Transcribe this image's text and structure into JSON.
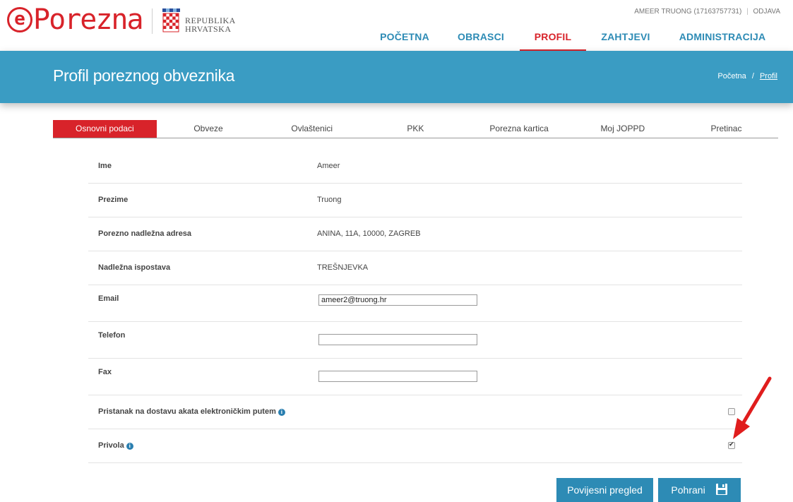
{
  "header": {
    "logo_prefix": "e",
    "logo_text": "Porezna",
    "country_line1": "REPUBLIKA",
    "country_line2": "HRVATSKA",
    "user_label": "AMEER TRUONG (17163757731)",
    "separator": "|",
    "logout_label": "ODJAVA"
  },
  "nav": {
    "items": [
      {
        "label": "POČETNA"
      },
      {
        "label": "OBRASCI"
      },
      {
        "label": "PROFIL",
        "active": true
      },
      {
        "label": "ZAHTJEVI"
      },
      {
        "label": "ADMINISTRACIJA"
      }
    ]
  },
  "banner": {
    "title": "Profil poreznog obveznika",
    "breadcrumb": {
      "home": "Početna",
      "separator": "/",
      "current": "Profil"
    }
  },
  "tabs": [
    {
      "label": "Osnovni podaci",
      "active": true
    },
    {
      "label": "Obveze"
    },
    {
      "label": "Ovlaštenici"
    },
    {
      "label": "PKK"
    },
    {
      "label": "Porezna kartica"
    },
    {
      "label": "Moj JOPPD"
    },
    {
      "label": "Pretinac"
    }
  ],
  "form": {
    "ime": {
      "label": "Ime",
      "value": "Ameer"
    },
    "prezime": {
      "label": "Prezime",
      "value": "Truong"
    },
    "adresa": {
      "label": "Porezno nadležna adresa",
      "value": "ANINA, 11A, 10000, ZAGREB"
    },
    "ispostava": {
      "label": "Nadležna ispostava",
      "value": "TREŠNJEVKA"
    },
    "email": {
      "label": "Email",
      "value": "ameer2@truong.hr",
      "placeholder": ""
    },
    "telefon": {
      "label": "Telefon",
      "value": "",
      "placeholder": ""
    },
    "fax": {
      "label": "Fax",
      "value": "",
      "placeholder": ""
    },
    "pristanak": {
      "label": "Pristanak na dostavu akata elektroničkim putem",
      "checked": false
    },
    "privola": {
      "label": "Privola",
      "checked": true
    },
    "info_glyph": "i"
  },
  "buttons": {
    "history_label": "Povijesni pregled",
    "save_label": "Pohrani"
  },
  "colors": {
    "brand_red": "#d8232a",
    "brand_blue": "#3a9cc3",
    "button_blue": "#2d8bb5",
    "nav_blue": "#2d8bb5"
  },
  "icons": [
    "info-icon",
    "save-icon",
    "coat-of-arms-icon",
    "annotation-arrow"
  ]
}
